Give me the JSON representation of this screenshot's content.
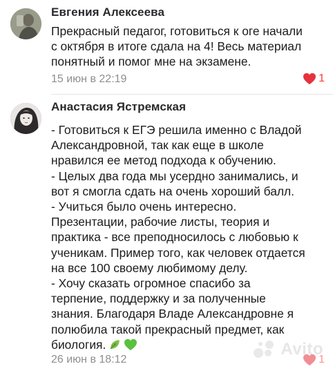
{
  "comments": [
    {
      "author": "Евгения Алексеева",
      "text": "Прекрасный педагог, готовиться к оге начали\nс октября в итоге сдала на 4! Весь материал\nпонятный и помог мне на экзамене.",
      "date": "15 июн в 22:19",
      "likes": "1",
      "liked": true
    },
    {
      "author": "Анастасия Ястремская",
      "text": "- Готовиться к ЕГЭ решила именно с Владой\nАлександровной, так как еще в школе\nнравился ее метод подхода к обучению.\n- Целых два года мы усердно занимались, и\nвот я смогла сдать на очень хороший балл.\n- Учиться было очень интересно.\nПрезентации, рабочие листы, теория и\nпрактика - все преподносилось с любовью к\nученикам. Пример того, как человек отдается\nна все 100 своему любимому делу.\n- Хочу сказать огромное спасибо за\nтерпение, поддержку и за полученные\nзнания. Благодаря Владе Александровне я\nполюбила такой прекрасный предмет, как\nбиология.",
      "date": "26 июн в 18:12",
      "likes": "1",
      "liked": true
    }
  ],
  "icons": {
    "like": "heart-icon",
    "emoji_1": "leaf-emoji-icon",
    "emoji_2": "green-heart-emoji-icon"
  },
  "colors": {
    "like": "#e5333e",
    "date": "#8e8e93",
    "leaf": "#7cc04b",
    "green_heart": "#59c13e"
  },
  "watermark": {
    "text": "Avito"
  }
}
